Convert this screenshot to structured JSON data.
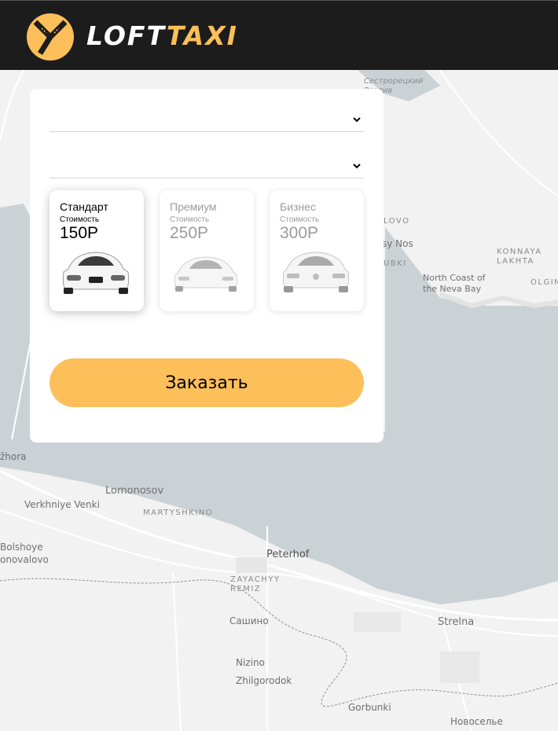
{
  "brand": {
    "logo_white": "LOFT",
    "logo_yellow": "TAXI",
    "accent": "#fdbf5a",
    "header_bg": "#1c1c1c"
  },
  "form": {
    "from_select": {
      "value": ""
    },
    "to_select": {
      "value": ""
    },
    "tariffs": [
      {
        "name": "Стандарт",
        "caption": "Стоимость",
        "price": "150Р",
        "selected": true
      },
      {
        "name": "Премиум",
        "caption": "Стоимость",
        "price": "250Р",
        "selected": false
      },
      {
        "name": "Бизнес",
        "caption": "Стоимость",
        "price": "300Р",
        "selected": false
      }
    ],
    "order_button": "Заказать"
  },
  "map": {
    "labels": {
      "sestroretsky": "Сестрорецкий Разлив",
      "lovo": "LOVO",
      "sy_nos": "sy Nos",
      "ubki": "UBKI",
      "konnaya": "KONNAYA LAKHTA",
      "north_coast": "North Coast of the Neva Bay",
      "olgin": "OLGIN",
      "zhora": "žhora",
      "lomonosov": "Lomonosov",
      "verkhniye": "Verkhniye Venki",
      "martyshkino": "MARTYSHKINO",
      "bolshoye": "Bolshoye",
      "onovalovo": "onovalovo",
      "peterhof": "Peterhof",
      "zayachiy": "ZAYACHYY REMIZ",
      "sashino": "Сашино",
      "strelna": "Strelna",
      "nizino": "Nizino",
      "zhilgorodok": "Zhilgorodok",
      "gorbunki": "Gorbunki",
      "novoselye": "Новоселье"
    }
  }
}
